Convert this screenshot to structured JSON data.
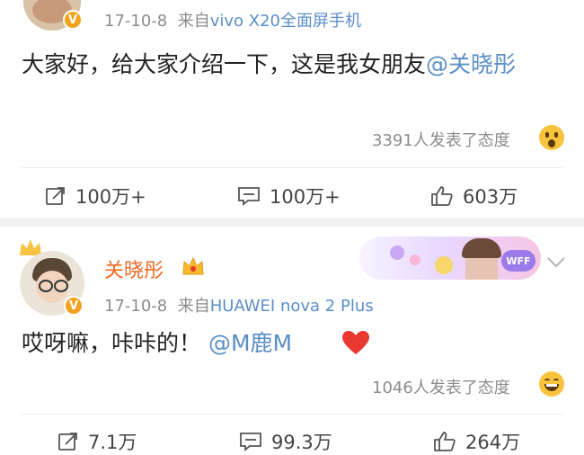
{
  "post1": {
    "timestamp": "17-10-8",
    "source_prefix": "来自",
    "source_device": "vivo X20全面屏手机",
    "text_main": "大家好，给大家介绍一下，这是我女朋友",
    "mention": "@关晓彤",
    "reactions": "3391人发表了态度",
    "reaction_emoji": "surprised-face",
    "actions": {
      "repost": "100万+",
      "comment": "100万+",
      "like": "603万"
    }
  },
  "post2": {
    "username": "关晓彤",
    "timestamp": "17-10-8",
    "source_prefix": "来自",
    "source_device": "HUAWEI nova 2 Plus",
    "text_main": "哎呀嘛，咔咔的！",
    "mention": "@M鹿M",
    "reactions": "1046人发表了态度",
    "reaction_emoji": "grinning-face",
    "banner_badge": "WFF",
    "actions": {
      "repost": "7.1万",
      "comment": "99.3万",
      "like": "264万"
    }
  },
  "colors": {
    "accent_link": "#5b8ec7",
    "username": "#f06a22",
    "verified_badge": "#f3a21e",
    "heart": "#e8382f"
  }
}
